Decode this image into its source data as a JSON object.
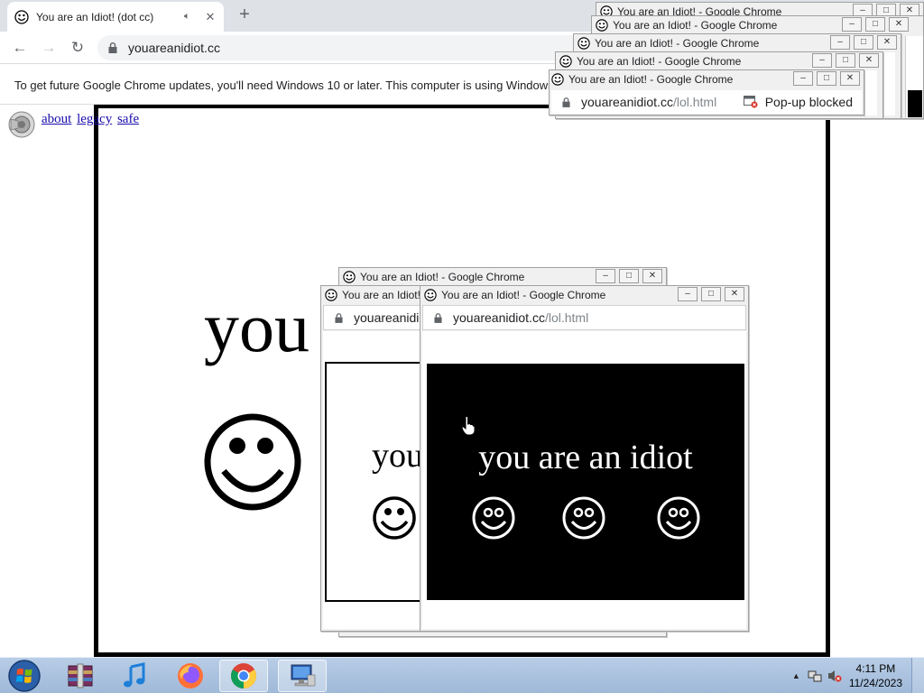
{
  "browser": {
    "tab": {
      "title": "You are an Idiot! (dot cc)",
      "sound_icon": "speaker-icon",
      "close_icon": "close-icon"
    },
    "new_tab_label": "+",
    "url": "youareanidiot.cc",
    "infobar_text": "To get future Google Chrome updates, you'll need Windows 10 or later. This computer is using Windows 7."
  },
  "page": {
    "links": [
      "about",
      "legacy",
      "safe"
    ],
    "big_text": "you"
  },
  "popups": {
    "window_title": "You are an Idiot! - Google Chrome",
    "url_host": "youareanidiot.cc",
    "url_path": "/lol.html",
    "blocked_text": "Pop-up blocked",
    "partial_url": "youareanidi",
    "idiot_text": "you are an idiot",
    "partial_idiot_text": "you",
    "edge_letter": "d"
  },
  "taskbar": {
    "time": "4:11 PM",
    "date": "11/24/2023"
  },
  "colors": {
    "taskbar": "#a9c2e0",
    "popup_black": "#000000",
    "link": "#1a0dab"
  }
}
